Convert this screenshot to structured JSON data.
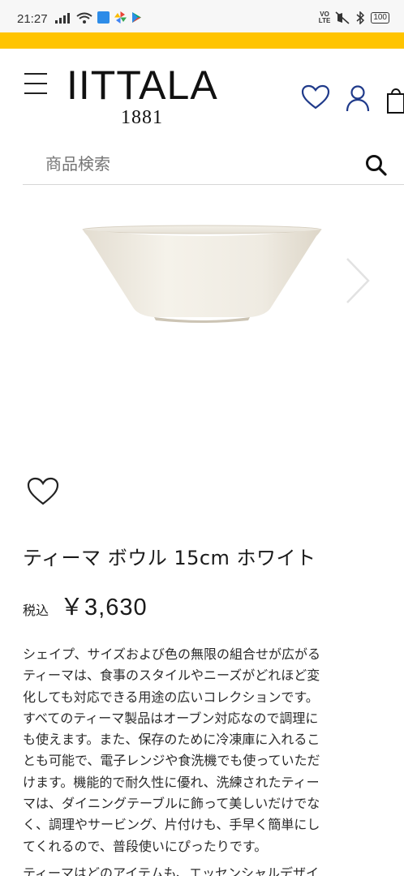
{
  "status_bar": {
    "time": "21:27",
    "battery": "100",
    "network_label": "VO LTE"
  },
  "header": {
    "logo_text": "IITTALA",
    "logo_year": "1881"
  },
  "search": {
    "placeholder": "商品検索"
  },
  "product": {
    "name": "ティーマ ボウル 15cm ホワイト",
    "tax_label": "税込",
    "price": "￥3,630",
    "description_lines": [
      "シェイプ、サイズおよび色の無限の組合せが広がる",
      "ティーマは、食事のスタイルやニーズがどれほど変",
      "化しても対応できる用途の広いコレクションです。",
      "すべてのティーマ製品はオーブン対応なので調理に",
      "も使えます。また、保存のために冷凍庫に入れるこ",
      "とも可能で、電子レンジや食洗機でも使っていただ",
      "けます。機能的で耐久性に優れ、洗練されたティー",
      "マは、ダイニングテーブルに飾って美しいだけでな",
      "く、調理やサービング、片付けも、手早く簡単にし",
      "てくれるので、普段使いにぴったりです。"
    ],
    "description_next": "ティーマはどのアイテムも、エッセンシャルデザイ"
  },
  "colors": {
    "accent": "#ffc400",
    "text": "#222222"
  }
}
